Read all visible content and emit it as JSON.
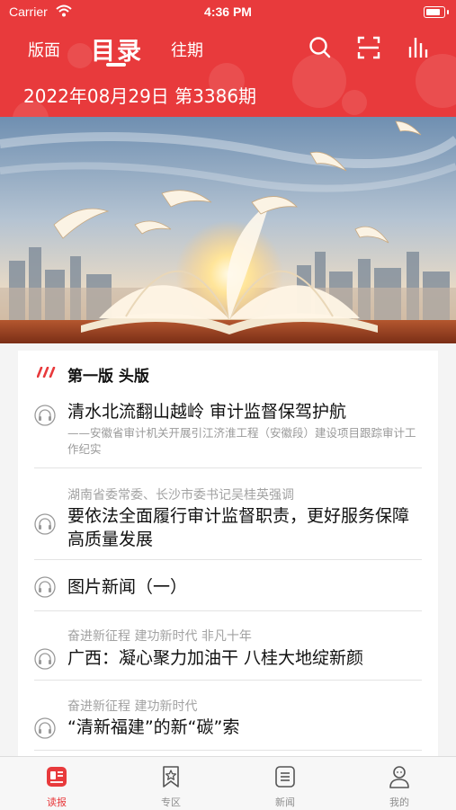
{
  "status_bar": {
    "carrier": "Carrier",
    "time": "4:36 PM"
  },
  "header": {
    "tabs": [
      {
        "label": "版面"
      },
      {
        "label": "目录"
      },
      {
        "label": "往期"
      }
    ],
    "active_tab": "目录",
    "issue_line": "2022年08月29日 第3386期",
    "icons": [
      "search-icon",
      "scan-icon",
      "stats-icon"
    ],
    "bg_color": "#e83a3c"
  },
  "section": {
    "title": "第一版 头版"
  },
  "articles": [
    {
      "title": "清水北流翻山越岭 审计监督保驾护航",
      "subtitle": "——安徽省审计机关开展引江济淮工程（安徽段）建设项目跟踪审计工作纪实"
    },
    {
      "pre_title": "湖南省委常委、长沙市委书记吴桂英强调",
      "title": "要依法全面履行审计监督职责，更好服务保障高质量发展"
    },
    {
      "title": "图片新闻（一）"
    },
    {
      "pre_title": "奋进新征程 建功新时代 非凡十年",
      "title": "广西：凝心聚力加油干 八桂大地绽新颜"
    },
    {
      "pre_title": "奋进新征程 建功新时代",
      "title": "“清新福建”的新“碳”索"
    }
  ],
  "tabbar": {
    "items": [
      {
        "label": "读报"
      },
      {
        "label": "专区"
      },
      {
        "label": "新闻"
      },
      {
        "label": "我的"
      }
    ],
    "active": "读报",
    "accent": "#e83a3c"
  }
}
